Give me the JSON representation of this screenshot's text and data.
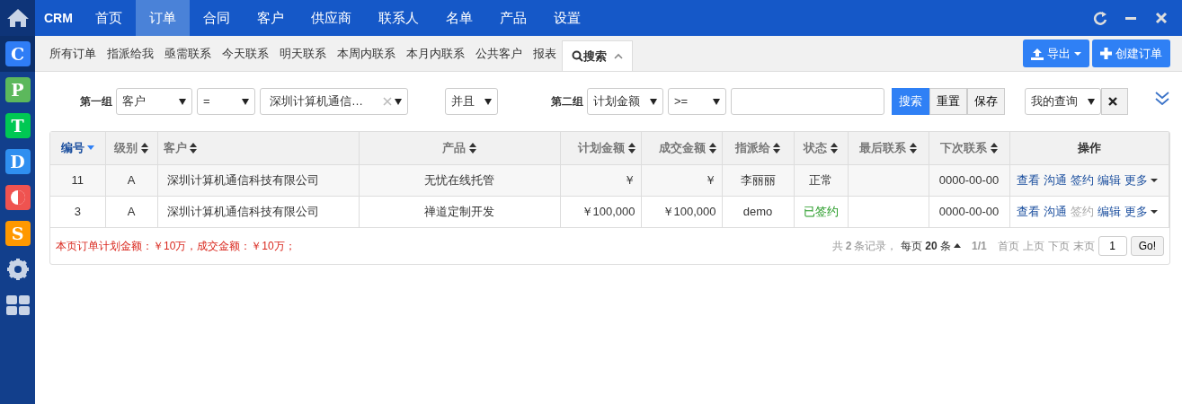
{
  "sidebar": {
    "apps": [
      {
        "kind": "letter",
        "label": "C",
        "color": "#2f7df6",
        "selected": true
      },
      {
        "kind": "letter",
        "label": "P",
        "color": "#5cb85c",
        "selected": false
      },
      {
        "kind": "letter",
        "label": "T",
        "color": "#00c853",
        "selected": false
      },
      {
        "kind": "letter",
        "label": "D",
        "color": "#2f8ff0",
        "selected": false
      },
      {
        "kind": "half",
        "color": "#ef5350",
        "selected": false
      },
      {
        "kind": "letter",
        "label": "S",
        "color": "#ff9800",
        "selected": false
      },
      {
        "kind": "gear"
      },
      {
        "kind": "grid"
      }
    ]
  },
  "topbar": {
    "brand": "CRM",
    "tabs": [
      {
        "label": "首页",
        "selected": false
      },
      {
        "label": "订单",
        "selected": true
      },
      {
        "label": "合同",
        "selected": false
      },
      {
        "label": "客户",
        "selected": false
      },
      {
        "label": "供应商",
        "selected": false
      },
      {
        "label": "联系人",
        "selected": false
      },
      {
        "label": "名单",
        "selected": false
      },
      {
        "label": "产品",
        "selected": false
      },
      {
        "label": "设置",
        "selected": false
      }
    ]
  },
  "subnav": {
    "items": [
      {
        "label": "所有订单",
        "selected": false
      },
      {
        "label": "指派给我",
        "selected": false
      },
      {
        "label": "亟需联系",
        "selected": false
      },
      {
        "label": "今天联系",
        "selected": false
      },
      {
        "label": "明天联系",
        "selected": false
      },
      {
        "label": "本周内联系",
        "selected": false
      },
      {
        "label": "本月内联系",
        "selected": false
      },
      {
        "label": "公共客户",
        "selected": false
      },
      {
        "label": "报表",
        "selected": false
      },
      {
        "label": "搜索",
        "selected": true,
        "kind": "search"
      }
    ],
    "buttons": [
      {
        "label": "导出",
        "kind": "export"
      },
      {
        "label": "创建订单",
        "kind": "create"
      }
    ]
  },
  "filter": {
    "group1": {
      "label": "第一组",
      "field": "客户",
      "operator": "=",
      "value": "深圳计算机通信…"
    },
    "andor": "并且",
    "group2": {
      "label": "第二组",
      "field": "计划金额",
      "operator": ">="
    },
    "buttons": [
      {
        "label": "搜索",
        "selected": true
      },
      {
        "label": "重置",
        "selected": false
      },
      {
        "label": "保存",
        "selected": false
      }
    ],
    "saved_query": "我的查询"
  },
  "table": {
    "columns": [
      {
        "label": "编号",
        "sortable": true,
        "sorted": true
      },
      {
        "label": "级别",
        "sortable": true,
        "sorted": false
      },
      {
        "label": "客户",
        "sortable": true,
        "sorted": false
      },
      {
        "label": "产品",
        "sortable": true,
        "sorted": false
      },
      {
        "label": "计划金额",
        "sortable": true,
        "sorted": false
      },
      {
        "label": "成交金额",
        "sortable": true,
        "sorted": false
      },
      {
        "label": "指派给",
        "sortable": true,
        "sorted": false
      },
      {
        "label": "状态",
        "sortable": true,
        "sorted": false
      },
      {
        "label": "最后联系",
        "sortable": true,
        "sorted": false
      },
      {
        "label": "下次联系",
        "sortable": true,
        "sorted": false
      },
      {
        "label": "操作",
        "sortable": false,
        "sorted": false
      }
    ],
    "rows": [
      {
        "cells": [
          "11",
          "A",
          "深圳计算机通信科技有限公司",
          "无忧在线托管",
          "￥",
          "￥",
          "李丽丽",
          "正常",
          "",
          "0000-00-00"
        ],
        "signed": false,
        "actions": [
          {
            "label": "查看",
            "disabled": false
          },
          {
            "label": "沟通",
            "disabled": false
          },
          {
            "label": "签约",
            "disabled": false
          },
          {
            "label": "编辑",
            "disabled": false
          },
          {
            "label": "更多",
            "disabled": false,
            "kind": "dropdown"
          }
        ]
      },
      {
        "cells": [
          "3",
          "A",
          "深圳计算机通信科技有限公司",
          "禅道定制开发",
          "￥100,000",
          "￥100,000",
          "demo",
          "已签约",
          "",
          "0000-00-00"
        ],
        "signed": true,
        "actions": [
          {
            "label": "查看",
            "disabled": false
          },
          {
            "label": "沟通",
            "disabled": false
          },
          {
            "label": "签约",
            "disabled": true
          },
          {
            "label": "编辑",
            "disabled": false
          },
          {
            "label": "更多",
            "disabled": false,
            "kind": "dropdown"
          }
        ]
      }
    ]
  },
  "footer": {
    "summary": "本页订单计划金额：￥10万，成交金额：￥10万；",
    "pager": {
      "total_pre": "共",
      "total": "2",
      "total_post": "条记录，",
      "per_page_pre": "每页",
      "per_page": "20",
      "per_page_post": "条",
      "pages": "1/1",
      "links": [
        "首页",
        "上页",
        "下页",
        "末页"
      ],
      "page_input": "1",
      "go": "Go!"
    }
  }
}
